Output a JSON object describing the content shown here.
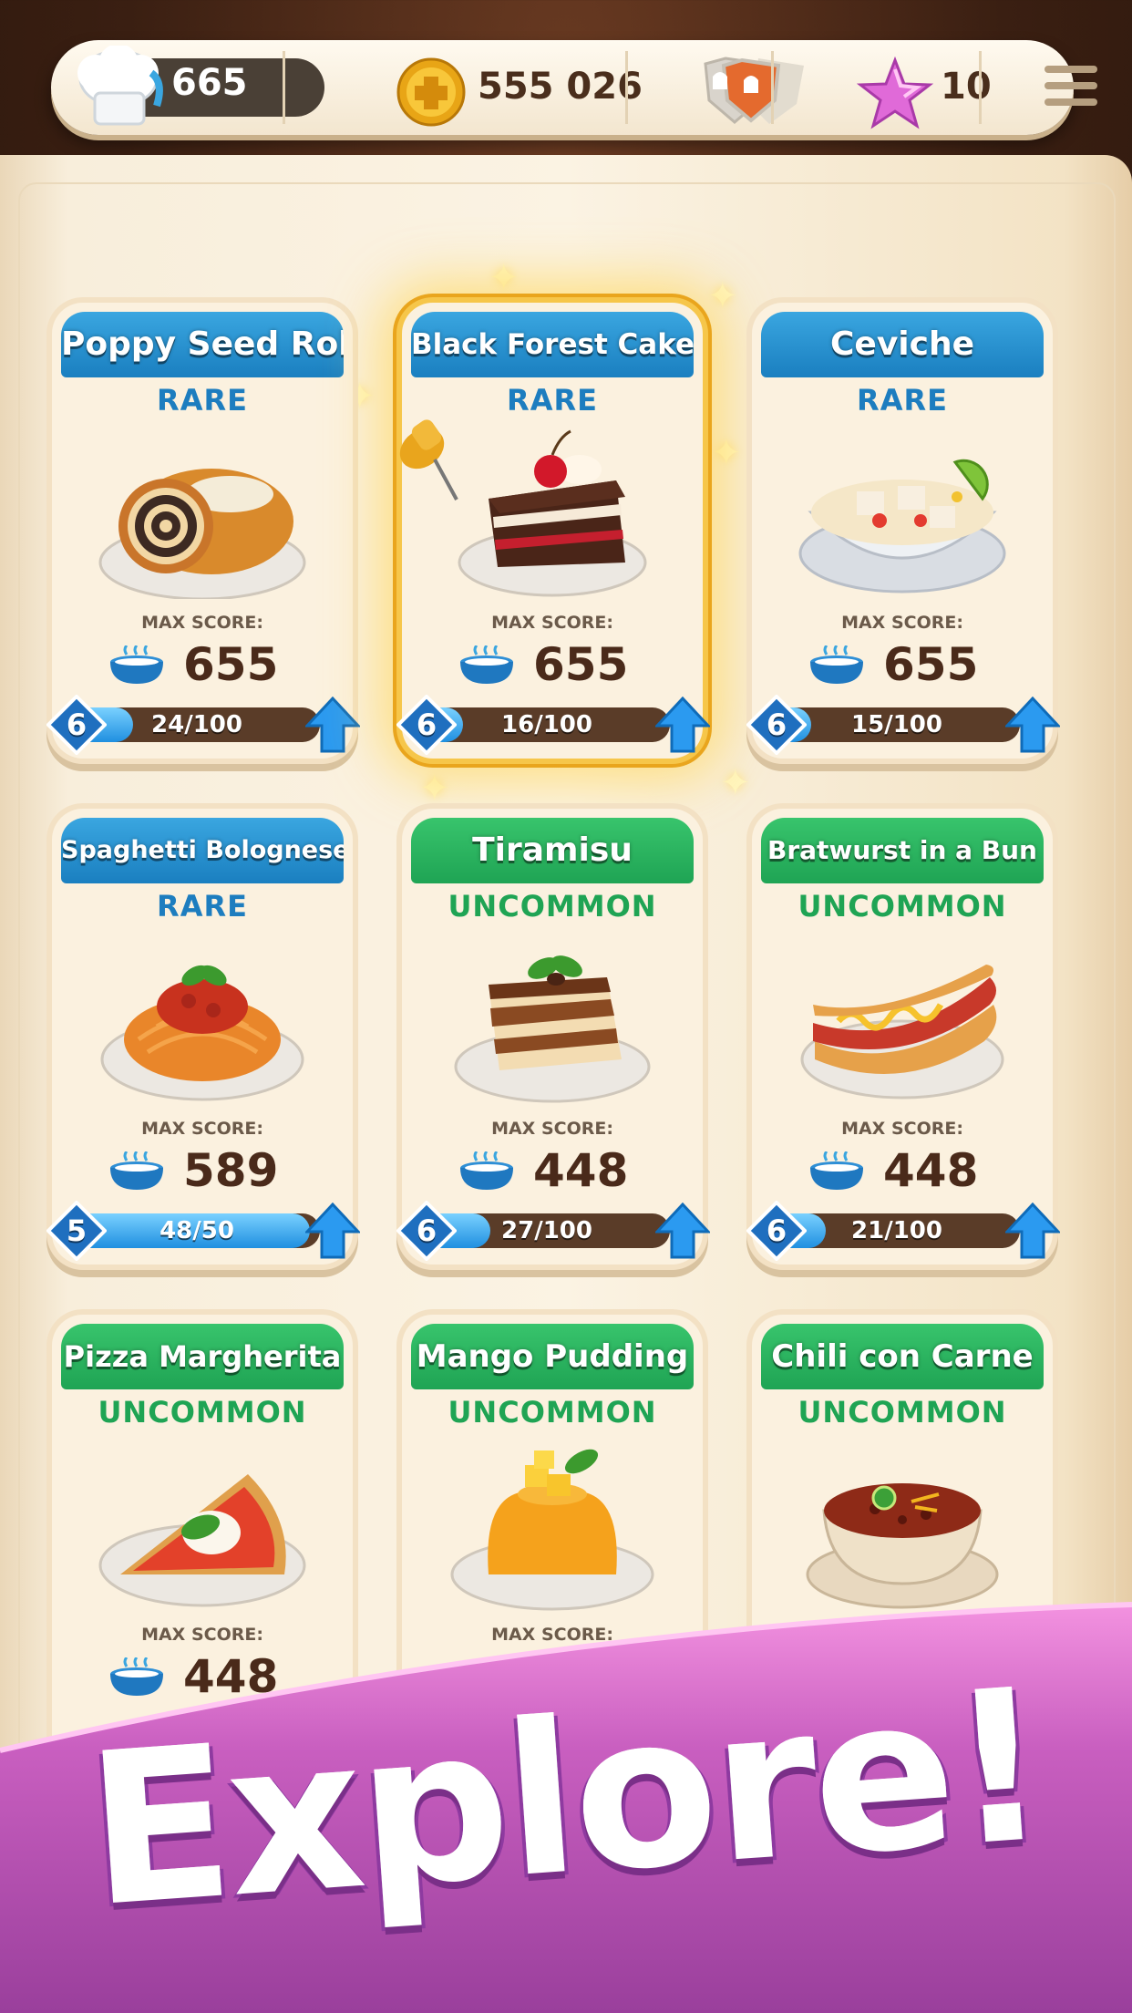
{
  "topbar": {
    "chef_count": "665",
    "coins": "555 026",
    "stars": "10"
  },
  "labels": {
    "max_score": "MAX SCORE:"
  },
  "cards": [
    {
      "title": "Poppy Seed Roll",
      "rarity": "RARE",
      "score": "655",
      "level": "6",
      "progress": "24/100",
      "fill": 0.24
    },
    {
      "title": "Black Forest Cake",
      "rarity": "RARE",
      "score": "655",
      "level": "6",
      "progress": "16/100",
      "fill": 0.16
    },
    {
      "title": "Ceviche",
      "rarity": "RARE",
      "score": "655",
      "level": "6",
      "progress": "15/100",
      "fill": 0.15
    },
    {
      "title": "Spaghetti Bolognese",
      "rarity": "RARE",
      "score": "589",
      "level": "5",
      "progress": "48/50",
      "fill": 0.96
    },
    {
      "title": "Tiramisu",
      "rarity": "UNCOMMON",
      "score": "448",
      "level": "6",
      "progress": "27/100",
      "fill": 0.27
    },
    {
      "title": "Bratwurst in a Bun",
      "rarity": "UNCOMMON",
      "score": "448",
      "level": "6",
      "progress": "21/100",
      "fill": 0.21
    },
    {
      "title": "Pizza Margherita",
      "rarity": "UNCOMMON",
      "score": "448"
    },
    {
      "title": "Mango Pudding",
      "rarity": "UNCOMMON"
    },
    {
      "title": "Chili con Carne",
      "rarity": "UNCOMMON"
    }
  ],
  "banner": {
    "text": "Explore!"
  },
  "icons": [
    "chef-hat-icon",
    "coin-icon",
    "shield-icon",
    "star-icon",
    "menu-icon",
    "soup-bowl-icon",
    "level-diamond-icon",
    "upgrade-arrow-icon",
    "pin-icon"
  ]
}
